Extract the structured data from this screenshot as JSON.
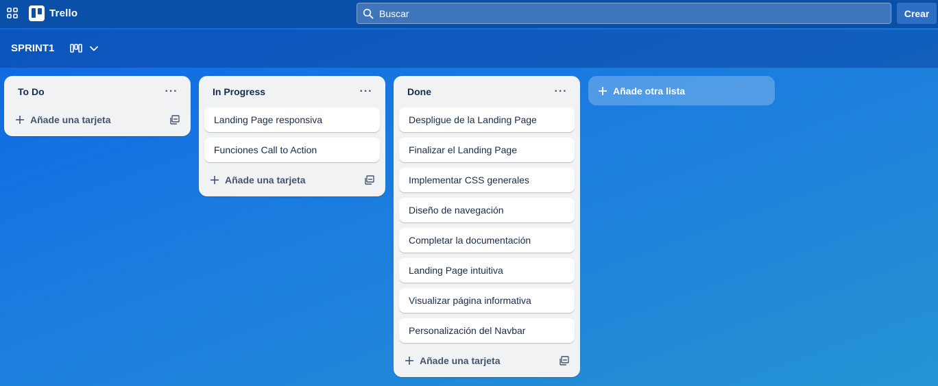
{
  "topbar": {
    "app_name": "Trello",
    "search_placeholder": "Buscar",
    "create_label": "Crear"
  },
  "board": {
    "title": "SPRINT1"
  },
  "lists": [
    {
      "title": "To Do",
      "cards": [],
      "add_card_label": "Añade una tarjeta"
    },
    {
      "title": "In Progress",
      "cards": [
        "Landing Page responsiva",
        "Funciones Call to Action"
      ],
      "add_card_label": "Añade una tarjeta"
    },
    {
      "title": "Done",
      "cards": [
        "Despligue de la Landing Page",
        "Finalizar el Landing Page",
        "Implementar CSS generales",
        "Diseño de navegación",
        "Completar la documentación",
        "Landing Page intuitiva",
        "Visualizar página informativa",
        "Personalización del Navbar"
      ],
      "add_card_label": "Añade una tarjeta"
    }
  ],
  "add_list_label": "Añade otra lista",
  "icons": {
    "apps": "apps-grid-icon",
    "search": "search-icon",
    "board_view": "board-view-icon",
    "chevron": "chevron-down-icon",
    "list_menu": "more-horizontal-icon",
    "add": "plus-icon",
    "template": "card-template-icon"
  },
  "colors": {
    "topbar": "#0a4fa8",
    "board_gradient_start": "#0c66e4",
    "board_gradient_end": "#2593d3",
    "list_bg": "#f1f2f4",
    "card_bg": "#ffffff",
    "text": "#172b4d"
  }
}
